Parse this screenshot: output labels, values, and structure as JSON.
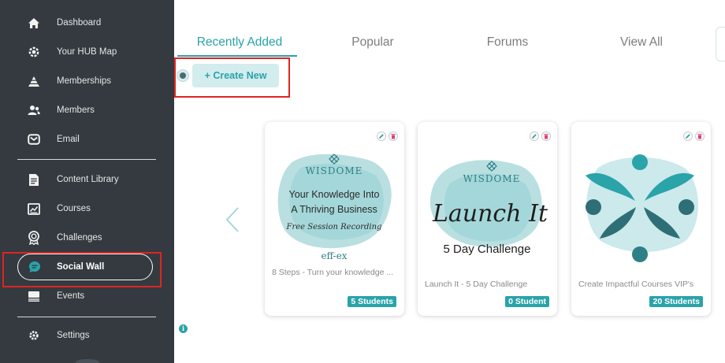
{
  "sidebar": {
    "items": [
      {
        "label": "Dashboard",
        "icon": "home-icon"
      },
      {
        "label": "Your HUB Map",
        "icon": "gear-map-icon"
      },
      {
        "label": "Memberships",
        "icon": "pyramid-icon"
      },
      {
        "label": "Members",
        "icon": "users-icon"
      },
      {
        "label": "Email",
        "icon": "email-icon"
      },
      {
        "label": "Content Library",
        "icon": "document-icon"
      },
      {
        "label": "Courses",
        "icon": "courses-icon"
      },
      {
        "label": "Challenges",
        "icon": "badge-icon"
      },
      {
        "label": "Social Wall",
        "icon": "chat-icon",
        "active": true
      },
      {
        "label": "Events",
        "icon": "events-icon"
      },
      {
        "label": "Settings",
        "icon": "gear-icon"
      }
    ]
  },
  "tabs": [
    {
      "label": "Recently Added",
      "active": true
    },
    {
      "label": "Popular"
    },
    {
      "label": "Forums"
    },
    {
      "label": "View All"
    }
  ],
  "create_button": "+ Create New",
  "cards": [
    {
      "title": "8 Steps - Turn your knowledge ...",
      "students": "5 Students",
      "thumb": {
        "brand": "WISDOME",
        "line1": "Your Knowledge Into",
        "line2": "A Thriving Business",
        "script": "Free Session Recording",
        "footer": "eff-ex"
      }
    },
    {
      "title": "Launch It - 5 Day Challenge",
      "students": "0 Student",
      "thumb": {
        "brand": "WISDOME",
        "script": "Launch It",
        "line1": "5 Day Challenge"
      }
    },
    {
      "title": "Create Impactful Courses VIP's",
      "students": "20 Students",
      "thumb": {}
    }
  ],
  "colors": {
    "accent": "#2aa3a9",
    "sidebar": "#343a40",
    "annotation": "#e02424"
  }
}
